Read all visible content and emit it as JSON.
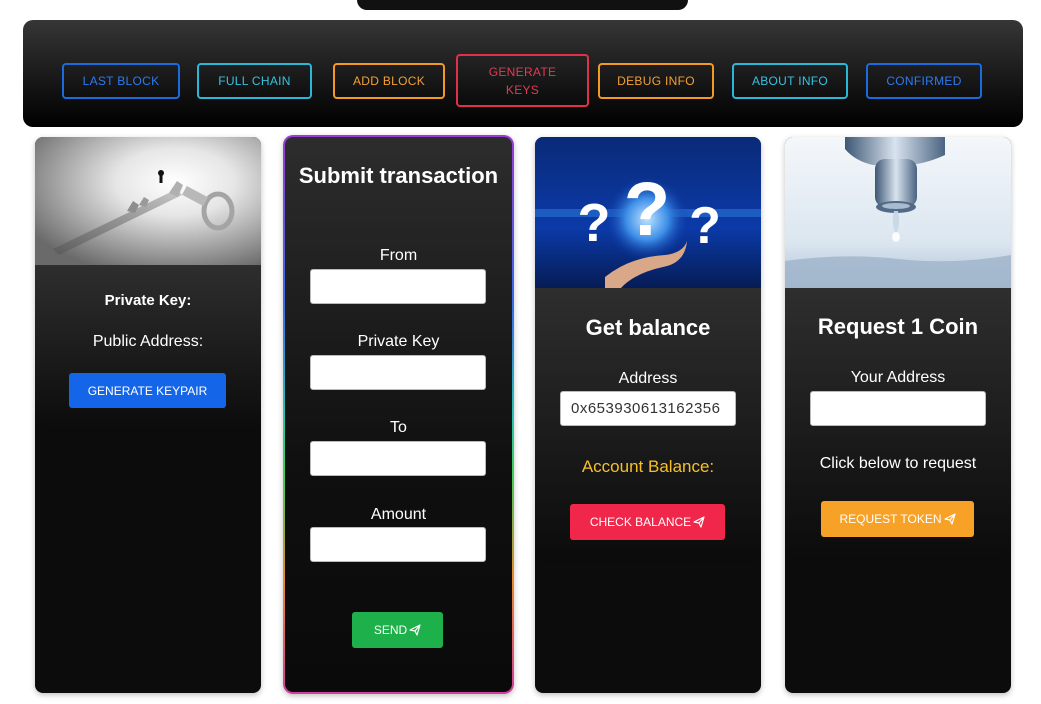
{
  "nav": {
    "last_block": "LAST BLOCK",
    "full_chain": "FULL CHAIN",
    "add_block": "ADD BLOCK",
    "generate_keys": "GENERATE KEYS",
    "debug_info": "DEBUG INFO",
    "about_info": "ABOUT INFO",
    "confirmed": "CONFIRMED"
  },
  "keypair_card": {
    "private_key_label": "Private Key:",
    "public_address_label": "Public Address:",
    "generate_button": "GENERATE KEYPAIR"
  },
  "transaction_card": {
    "title": "Submit transaction",
    "from_label": "From",
    "from_value": "",
    "private_key_label": "Private Key",
    "private_key_value": "",
    "to_label": "To",
    "to_value": "",
    "amount_label": "Amount",
    "amount_value": "",
    "send_button": "SEND"
  },
  "balance_card": {
    "title": "Get balance",
    "address_label": "Address",
    "address_value": "0x653930613162356",
    "balance_label": "Account Balance:",
    "check_button": "CHECK BALANCE"
  },
  "faucet_card": {
    "title": "Request 1 Coin",
    "address_label": "Your Address",
    "address_value": "",
    "hint": "Click below to request",
    "request_button": "REQUEST TOKEN"
  },
  "colors": {
    "blue_button": "#1565e8",
    "green_button": "#1eb04a",
    "red_button": "#f0264b",
    "orange_button": "#f7a126",
    "balance_label": "#f5c02a"
  }
}
